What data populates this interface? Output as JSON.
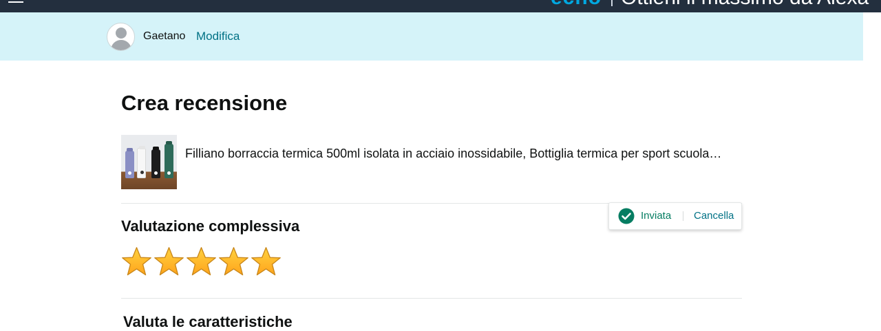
{
  "nav": {
    "menu_icon": "hamburger-menu-icon",
    "banner_brand": "echo",
    "banner_tagline": "Ottieni il massimo da Alexa"
  },
  "user": {
    "avatar_icon": "user-avatar-icon",
    "name": "Gaetano",
    "edit_label": "Modifica"
  },
  "page": {
    "title": "Crea recensione"
  },
  "product": {
    "name": "Filliano borraccia termica 500ml isolata in acciaio inossidabile, Bottiglia termica per sport scuola…"
  },
  "rating": {
    "title": "Valutazione complessiva",
    "value": 5,
    "max": 5,
    "star_color": "#ffa41c"
  },
  "status": {
    "icon": "check-circle-icon",
    "sent_label": "Inviata",
    "cancel_label": "Cancella",
    "accent": "#067d62"
  },
  "features": {
    "title": "Valuta le caratteristiche"
  }
}
